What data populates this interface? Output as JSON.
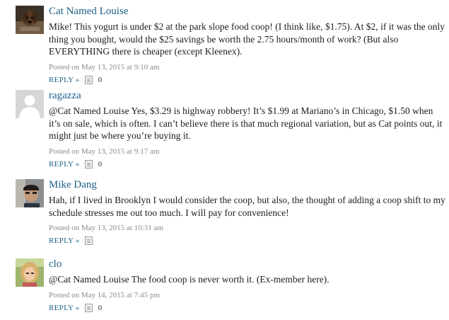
{
  "comments": [
    {
      "author": "Cat Named Louise",
      "text": "Mike! This yogurt is under $2 at the park slope food coop! (I think like, $1.75). At $2, if it was the only thing you bought, would the $25 savings be worth the 2.75 hours/month of work? (But also EVERYTHING there is cheaper (except Kleenex).",
      "posted": "Posted on May 13, 2015 at 9:10 am",
      "reply_label": "REPLY »",
      "likes": "0",
      "avatar": "dog-photo-avatar"
    },
    {
      "author": "ragazza",
      "text": "@Cat Named Louise Yes, $3.29 is highway robbery! It’s $1.99 at Mariano’s in Chicago, $1.50 when it’s on sale, which is often. I can’t believe there is that much regional variation, but as Cat points out, it might just be where you’re buying it.",
      "posted": "Posted on May 13, 2015 at 9:17 am",
      "reply_label": "REPLY »",
      "likes": "0",
      "avatar": "default-person-avatar"
    },
    {
      "author": "Mike Dang",
      "text": "Hah, if I lived in Brooklyn I would consider the coop, but also, the thought of adding a coop shift to my schedule stresses me out too much. I will pay for convenience!",
      "posted": "Posted on May 13, 2015 at 10:31 am",
      "reply_label": "REPLY »",
      "likes": "",
      "avatar": "man-photo-avatar"
    },
    {
      "author": "clo",
      "text": "@Cat Named Louise The food coop is never worth it. (Ex-member here).",
      "posted": "Posted on May 14, 2015 at 7:45 pm",
      "reply_label": "REPLY »",
      "likes": "0",
      "avatar": "woman-photo-avatar"
    }
  ],
  "colors": {
    "link": "#1d5f8a",
    "meta": "#8a8a8a",
    "text": "#1b1b1b"
  }
}
